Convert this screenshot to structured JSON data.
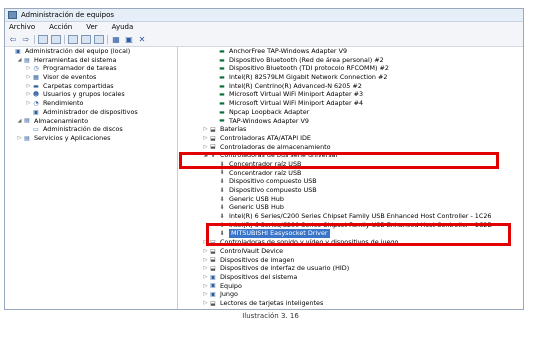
{
  "window": {
    "title": "Administración de equipos"
  },
  "menu": [
    "Archivo",
    "Acción",
    "Ver",
    "Ayuda"
  ],
  "left_tree": [
    {
      "label": "Administración del equipo (local)",
      "indent": 0,
      "twisty": "",
      "icon": "computer-icon",
      "glyph": "▣"
    },
    {
      "label": "Herramientas del sistema",
      "indent": 1,
      "twisty": "◢",
      "icon": "tools-icon",
      "glyph": "▤"
    },
    {
      "label": "Programador de tareas",
      "indent": 2,
      "twisty": "▷",
      "icon": "clock-icon",
      "glyph": "◷"
    },
    {
      "label": "Visor de eventos",
      "indent": 2,
      "twisty": "▷",
      "icon": "event-viewer-icon",
      "glyph": "▦"
    },
    {
      "label": "Carpetas compartidas",
      "indent": 2,
      "twisty": "▷",
      "icon": "shared-folder-icon",
      "glyph": "▬"
    },
    {
      "label": "Usuarios y grupos locales",
      "indent": 2,
      "twisty": "▷",
      "icon": "users-icon",
      "glyph": "☻"
    },
    {
      "label": "Rendimiento",
      "indent": 2,
      "twisty": "▷",
      "icon": "performance-icon",
      "glyph": "◔"
    },
    {
      "label": "Administrador de dispositivos",
      "indent": 2,
      "twisty": "",
      "icon": "device-manager-icon",
      "glyph": "▣"
    },
    {
      "label": "Almacenamiento",
      "indent": 1,
      "twisty": "◢",
      "icon": "storage-icon",
      "glyph": "▤"
    },
    {
      "label": "Administración de discos",
      "indent": 2,
      "twisty": "",
      "icon": "disk-icon",
      "glyph": "▭"
    },
    {
      "label": "Servicios y Aplicaciones",
      "indent": 1,
      "twisty": "▷",
      "icon": "services-icon",
      "glyph": "▤"
    }
  ],
  "right_tree": [
    {
      "label": "AnchorFree TAP-Windows Adapter V9",
      "indent": 3,
      "twisty": "",
      "icon": "network-adapter-icon",
      "kind": "net"
    },
    {
      "label": "Dispositivo Bluetooth (Red de área personal) #2",
      "indent": 3,
      "twisty": "",
      "icon": "network-adapter-icon",
      "kind": "net"
    },
    {
      "label": "Dispositivo Bluetooth (TDI protocolo RFCOMM) #2",
      "indent": 3,
      "twisty": "",
      "icon": "network-adapter-icon",
      "kind": "net"
    },
    {
      "label": "Intel(R) 82579LM Gigabit Network Connection #2",
      "indent": 3,
      "twisty": "",
      "icon": "network-adapter-icon",
      "kind": "net"
    },
    {
      "label": "Intel(R) Centrino(R) Advanced-N 6205 #2",
      "indent": 3,
      "twisty": "",
      "icon": "network-adapter-icon",
      "kind": "net"
    },
    {
      "label": "Microsoft Virtual WiFi Miniport Adapter #3",
      "indent": 3,
      "twisty": "",
      "icon": "network-adapter-icon",
      "kind": "net"
    },
    {
      "label": "Microsoft Virtual WiFi Miniport Adapter #4",
      "indent": 3,
      "twisty": "",
      "icon": "network-adapter-icon",
      "kind": "net"
    },
    {
      "label": "Npcap Loopback Adapter",
      "indent": 3,
      "twisty": "",
      "icon": "network-adapter-icon",
      "kind": "net"
    },
    {
      "label": "TAP-Windows Adapter V9",
      "indent": 3,
      "twisty": "",
      "icon": "network-adapter-icon",
      "kind": "net"
    },
    {
      "label": "Baterías",
      "indent": 2,
      "twisty": "▷",
      "icon": "battery-icon",
      "kind": "dev"
    },
    {
      "label": "Controladoras ATA/ATAPI IDE",
      "indent": 2,
      "twisty": "▷",
      "icon": "ide-controller-icon",
      "kind": "dev"
    },
    {
      "label": "Controladoras de almacenamiento",
      "indent": 2,
      "twisty": "▷",
      "icon": "storage-controller-icon",
      "kind": "dev"
    },
    {
      "label": "Controladoras de bus serie universal",
      "indent": 2,
      "twisty": "◢",
      "icon": "usb-icon",
      "kind": "dev"
    },
    {
      "label": "Concentrador raíz USB",
      "indent": 3,
      "twisty": "",
      "icon": "usb-icon",
      "kind": "dev"
    },
    {
      "label": "Concentrador raíz USB",
      "indent": 3,
      "twisty": "",
      "icon": "usb-icon",
      "kind": "dev"
    },
    {
      "label": "Dispositivo compuesto USB",
      "indent": 3,
      "twisty": "",
      "icon": "usb-icon",
      "kind": "dev"
    },
    {
      "label": "Dispositivo compuesto USB",
      "indent": 3,
      "twisty": "",
      "icon": "usb-icon",
      "kind": "dev"
    },
    {
      "label": "Generic USB Hub",
      "indent": 3,
      "twisty": "",
      "icon": "usb-icon",
      "kind": "dev"
    },
    {
      "label": "Generic USB Hub",
      "indent": 3,
      "twisty": "",
      "icon": "usb-icon",
      "kind": "dev"
    },
    {
      "label": "Intel(R) 6 Series/C200 Series Chipset Family USB Enhanced Host Controller - 1C26",
      "indent": 3,
      "twisty": "",
      "icon": "usb-icon",
      "kind": "dev"
    },
    {
      "label": "Intel(R) 6 Series/C200 Series Chipset Family USB Enhanced Host Controller - 1C2D",
      "indent": 3,
      "twisty": "",
      "icon": "usb-icon",
      "kind": "dev"
    },
    {
      "label": "MITSUBISHI Easysocket Driver",
      "indent": 3,
      "twisty": "",
      "icon": "usb-icon",
      "kind": "dev",
      "selected": true
    },
    {
      "label": "Controladoras de sonido y vídeo y dispositivos de juego",
      "indent": 2,
      "twisty": "▷",
      "icon": "sound-icon",
      "kind": "dev"
    },
    {
      "label": "ControlVault Device",
      "indent": 2,
      "twisty": "▷",
      "icon": "controlvault-icon",
      "kind": "dev"
    },
    {
      "label": "Dispositivos de imagen",
      "indent": 2,
      "twisty": "▷",
      "icon": "camera-icon",
      "kind": "dev"
    },
    {
      "label": "Dispositivos de interfaz de usuario (HID)",
      "indent": 2,
      "twisty": "▷",
      "icon": "hid-icon",
      "kind": "dev"
    },
    {
      "label": "Dispositivos del sistema",
      "indent": 2,
      "twisty": "▷",
      "icon": "system-devices-icon",
      "kind": "pc"
    },
    {
      "label": "Equipo",
      "indent": 2,
      "twisty": "▷",
      "icon": "computer-icon",
      "kind": "pc"
    },
    {
      "label": "Jungo",
      "indent": 2,
      "twisty": "▷",
      "icon": "jungo-icon",
      "kind": "pc"
    },
    {
      "label": "Lectores de tarjetas inteligentes",
      "indent": 2,
      "twisty": "▷",
      "icon": "smartcard-reader-icon",
      "kind": "dev"
    }
  ],
  "caption": "Ilustración 3. 16",
  "colors": {
    "highlight": "#e30000",
    "selection": "#3874c8"
  }
}
